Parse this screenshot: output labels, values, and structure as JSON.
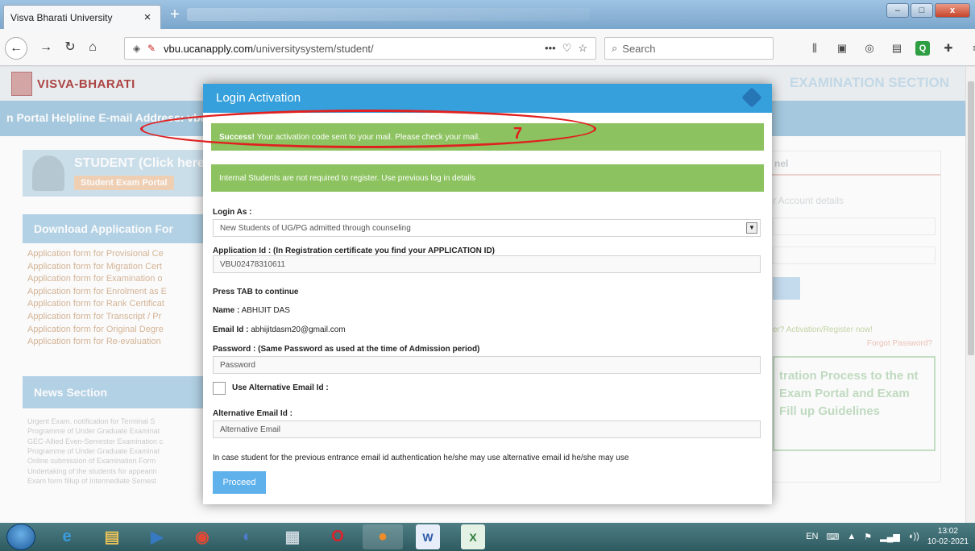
{
  "browser": {
    "tab_title": "Visva Bharati University",
    "tab_close": "×",
    "new_tab": "+",
    "url_host": "vbu.ucanapply.com",
    "url_path": "/universitysystem/student/",
    "url_more": "•••",
    "search_placeholder": "Search",
    "window": {
      "minimize": "–",
      "maximize": "□",
      "close": "x"
    }
  },
  "page": {
    "logo_text": "VISVA-BHARATI",
    "exam_section": "EXAMINATION SECTION",
    "helpline": "n Portal Helpline E-mail Address: vbexam",
    "student_title": "STUDENT (Click here",
    "student_sub": "Student Exam Portal",
    "download_head": "Download Application For",
    "download_items": [
      "Application form for Provisional Ce",
      "Application form for Migration Cert",
      "Application form for Examination o",
      "Application form for Enrolment as E",
      "Application form for Rank Certificat",
      "Application form for Transcript / Pr",
      "Application form for Original Degre",
      "Application form for Re-evaluation"
    ],
    "news_head": "News Section",
    "news_items": [
      "Urgent Exam. notification for Terminal S",
      "Programme of Under Graduate Examinat",
      "GEC-Allied Even-Semester Examination c",
      "Programme of Under Graduate Examinat",
      "Online submission of Examination Form",
      "Undertaking of the students for appearin",
      "Exam form fillup of Intermediate Semest"
    ],
    "panel_title": "nel",
    "account_details": "r Account details",
    "activation_link": "er? Activation/Register now!",
    "forgot": "Forgot Password?",
    "guide_text": "tration Process to the nt Exam Portal and Exam Fill up Guidelines"
  },
  "modal": {
    "title": "Login Activation",
    "success_strong": "Success!",
    "success_text": "Your activation code sent to your mail. Please check your mail.",
    "internal_note": "Internal Students are not required to register. Use previous log in details",
    "login_as_label": "Login As :",
    "login_as_value": "New Students of UG/PG admitted through counseling",
    "app_id_label": "Application Id : (In Registration certificate you find your APPLICATION ID)",
    "app_id_value": "VBU02478310611",
    "press_tab": "Press TAB to continue",
    "name_label": "Name :",
    "name_value": "ABHIJIT DAS",
    "email_label": "Email Id :",
    "email_value": "abhijitdasm20@gmail.com",
    "password_label": "Password : (Same Password as used at the time of Admission period)",
    "password_placeholder": "Password",
    "alt_email_checkbox": "Use Alternative Email Id :",
    "alt_email_label": "Alternative Email Id :",
    "alt_email_placeholder": "Alternative Email",
    "footnote": "In case student for the previous entrance email id authentication he/she may use alternative email id he/she may use",
    "proceed": "Proceed"
  },
  "annotation": {
    "number": "7",
    "color": "#e02020"
  },
  "taskbar": {
    "lang": "EN",
    "time": "13:02",
    "date": "10-02-2021"
  }
}
